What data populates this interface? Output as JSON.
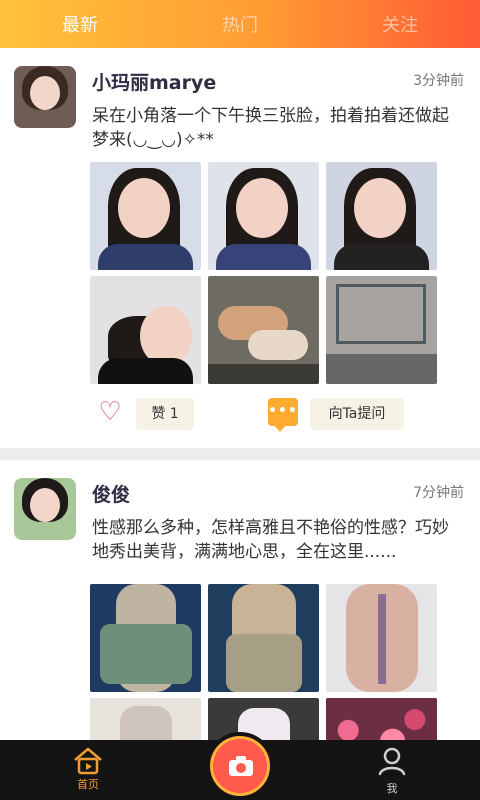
{
  "header": {
    "tabs": [
      "最新",
      "热门",
      "关注"
    ],
    "active_tab_index": 0
  },
  "posts": [
    {
      "username": "小玛丽marye",
      "time": "3分钟前",
      "text": "呆在小角落一个下午换三张脸，拍着拍着还做起梦来(◡‿◡)✧**",
      "like_label": "赞 1",
      "comment_label": "向Ta提问",
      "photo_count": 6
    },
    {
      "username": "俊俊",
      "time": "7分钟前",
      "text": "性感那么多种，怎样高雅且不艳俗的性感？巧妙地秀出美背，满满地心思，全在这里......",
      "photo_count": 6
    }
  ],
  "bottom_nav": {
    "home_label": "首页",
    "me_label": "我"
  },
  "colors": {
    "accent_orange": "#ff9b33",
    "accent_red": "#ff5b34",
    "like_pink": "#e84e6c"
  }
}
